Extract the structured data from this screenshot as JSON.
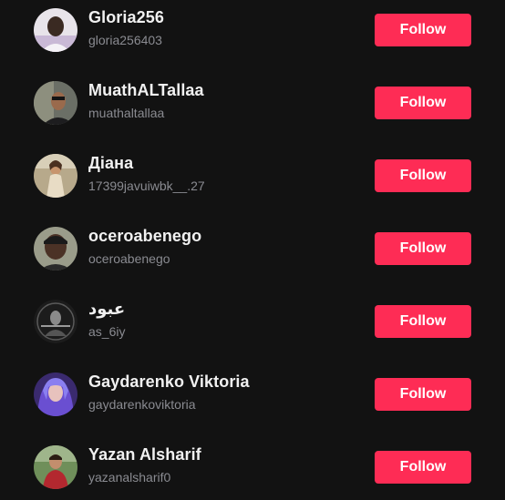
{
  "suggested_accounts": [
    {
      "name": "Gloria256",
      "handle": "gloria256403",
      "button": "Follow"
    },
    {
      "name": "MuathALTallaa",
      "handle": "muathaltallaa",
      "button": "Follow"
    },
    {
      "name": "Діана",
      "handle": "17399javuiwbk__.27",
      "button": "Follow"
    },
    {
      "name": "oceroabenego",
      "handle": "oceroabenego",
      "button": "Follow"
    },
    {
      "name": "عبود",
      "handle": "as_6iy",
      "button": "Follow"
    },
    {
      "name": "Gaydarenko Viktoria",
      "handle": "gaydarenkoviktoria",
      "button": "Follow"
    },
    {
      "name": "Yazan Alsharif",
      "handle": "yazanalsharif0",
      "button": "Follow"
    }
  ],
  "colors": {
    "background": "#121212",
    "follow_button": "#fe2c55",
    "name_text": "#f1f1f1",
    "handle_text": "#8a8b91"
  }
}
